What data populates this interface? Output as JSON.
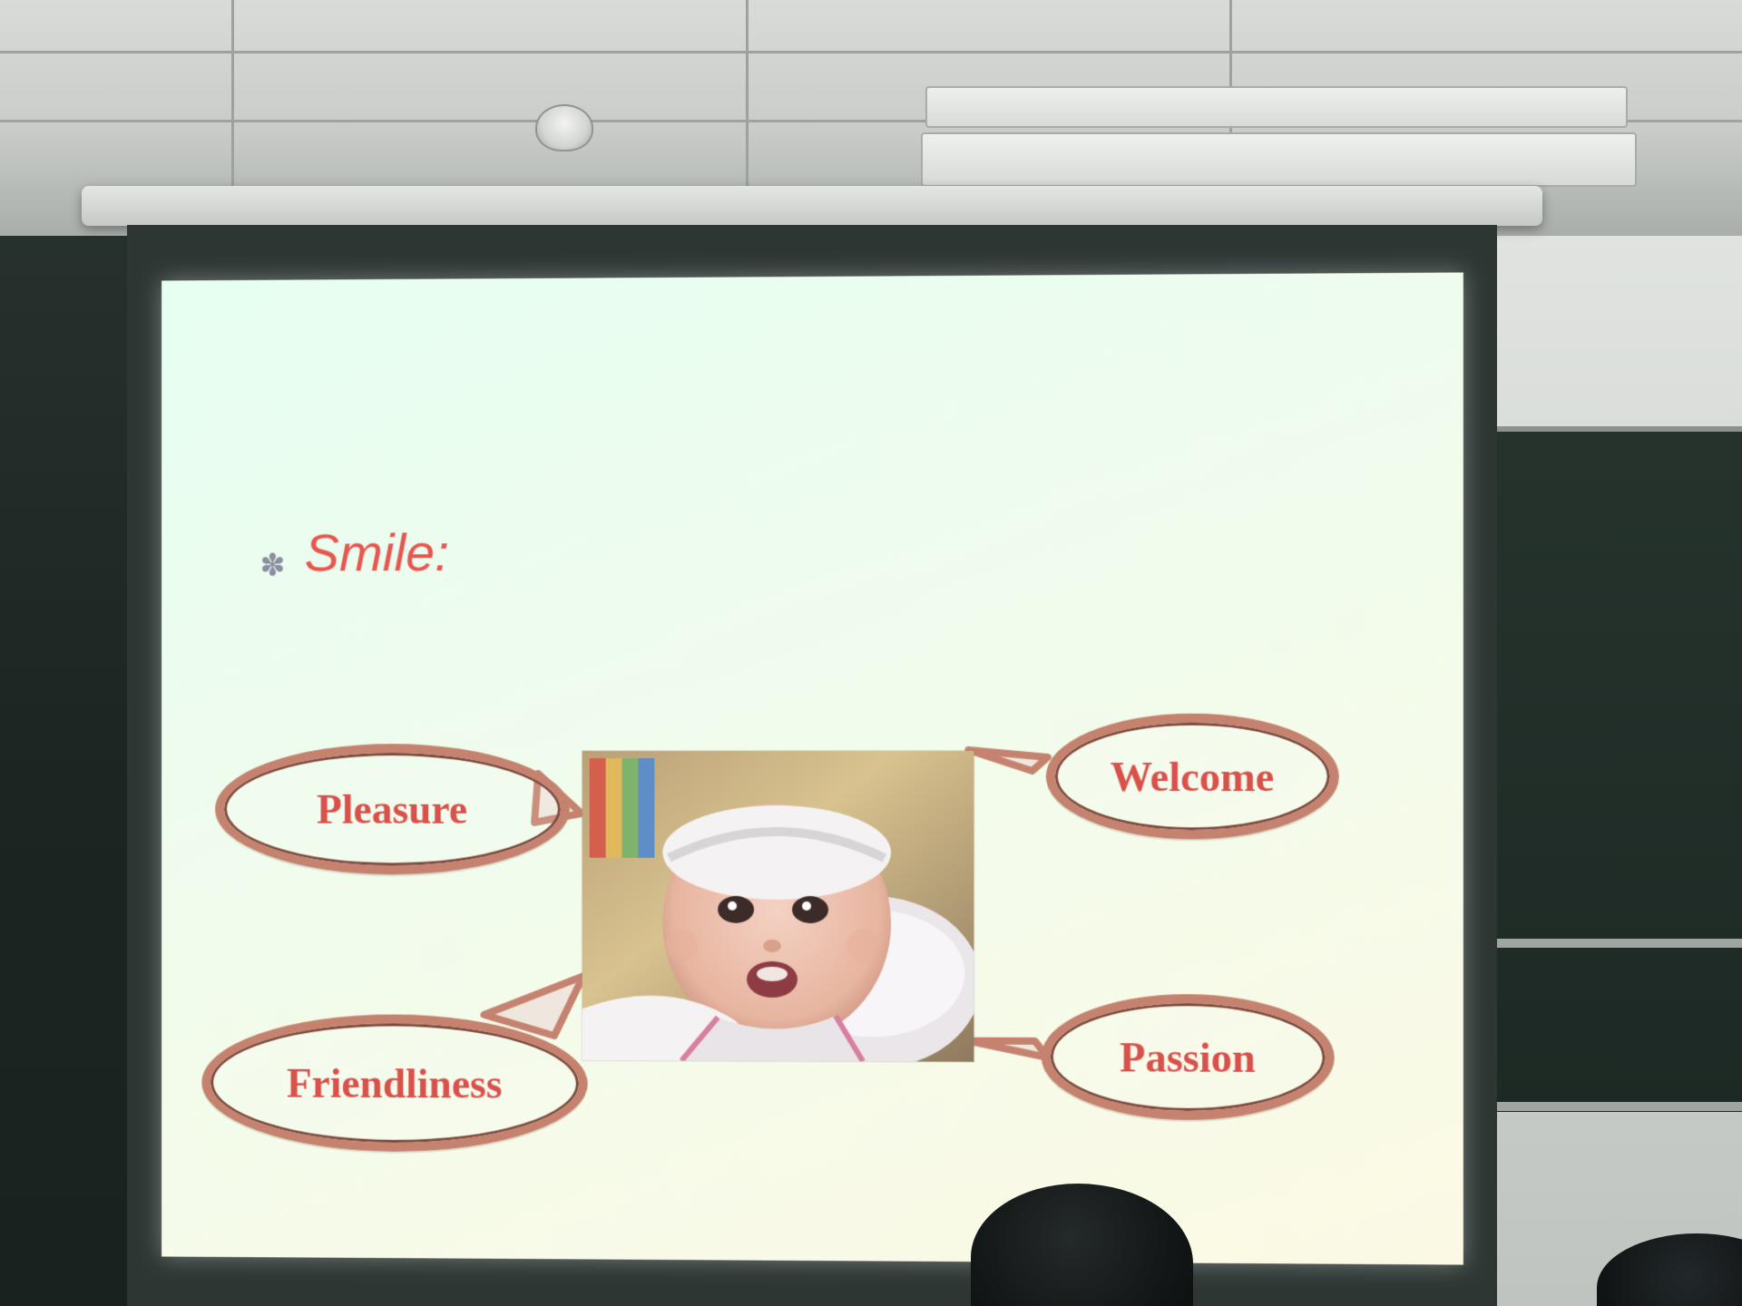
{
  "slide": {
    "bullet_symbol": "✽",
    "title": "Smile:",
    "bubbles": [
      {
        "label": "Pleasure"
      },
      {
        "label": "Welcome"
      },
      {
        "label": "Friendliness"
      },
      {
        "label": "Passion"
      }
    ]
  },
  "colors": {
    "title_red": "#e8574f",
    "bubble_text_red": "#d9514b",
    "bubble_ring": "#c5836f",
    "slide_bg_start": "#e6fff1",
    "slide_bg_end": "#fbf9e4"
  },
  "icons": {
    "bullet": "asterisk-bullet-icon",
    "camera": "dome-camera-icon"
  }
}
